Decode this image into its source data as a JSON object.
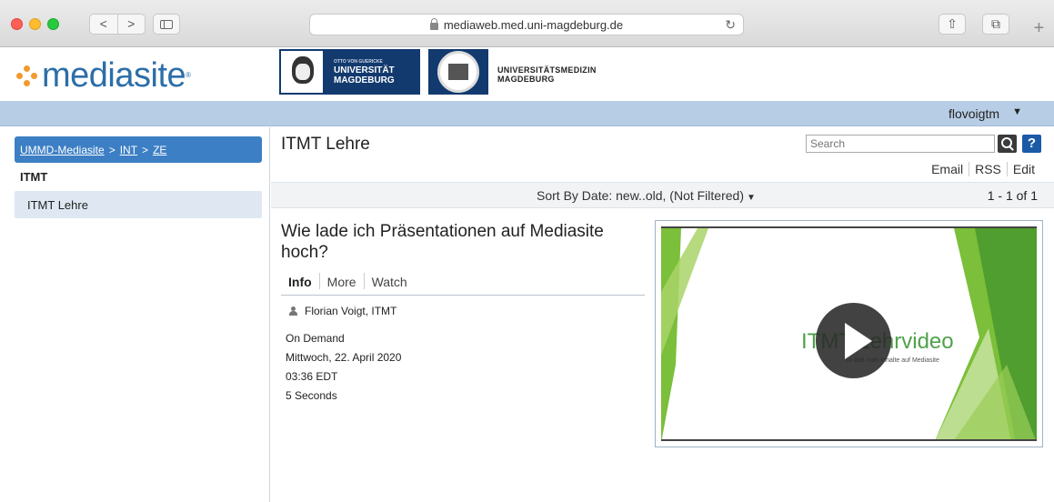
{
  "browser": {
    "back": "<",
    "forward": ">",
    "url": "mediaweb.med.uni-magdeburg.de",
    "reload": "↻",
    "share": "⇧",
    "tabs": "⧉",
    "new_tab": "+"
  },
  "header": {
    "logo_text": "mediasite",
    "logo_mark": "®",
    "university": {
      "line_small": "OTTO VON GUERICKE",
      "line1": "UNIVERSITÄT",
      "line2": "MAGDEBURG"
    },
    "faculty": {
      "line1": "UNIVERSITÄTSMEDIZIN",
      "line2": "MAGDEBURG"
    }
  },
  "userbar": {
    "username": "flovoigtm",
    "caret": "▼"
  },
  "sidebar": {
    "breadcrumb": [
      {
        "label": "UMMD-Mediasite"
      },
      {
        "label": "INT"
      },
      {
        "label": "ZE"
      }
    ],
    "breadcrumb_sep": ">",
    "folder_title": "ITMT",
    "items": [
      {
        "label": "ITMT Lehre",
        "selected": true
      }
    ]
  },
  "main": {
    "title": "ITMT Lehre",
    "search": {
      "placeholder": "Search"
    },
    "help": "?",
    "actions": [
      "Email",
      "RSS",
      "Edit"
    ],
    "sort": {
      "label": "Sort By Date: new..old, (Not Filtered)",
      "caret": "▼"
    },
    "pager": "1 - 1 of 1",
    "presentation": {
      "title": "Wie lade ich Präsentationen auf Mediasite hoch?",
      "tabs": [
        "Info",
        "More",
        "Watch"
      ],
      "active_tab": "Info",
      "presenter": "Florian Voigt, ITMT",
      "type": "On Demand",
      "date": "Mittwoch, 22. April 2020",
      "time": "03:36 EDT",
      "duration": "5 Seconds",
      "thumbnail": {
        "title": "ITMT Lehrvideo",
        "subtitle": "So lädt man Inhalte auf Mediasite",
        "accent_color": "#7bbf3a"
      }
    }
  },
  "colors": {
    "brand_blue": "#2c6ea8",
    "breadcrumb_bg": "#3d7fc4",
    "userbar_bg": "#b7cde5",
    "logo_orange": "#f29a2e"
  }
}
